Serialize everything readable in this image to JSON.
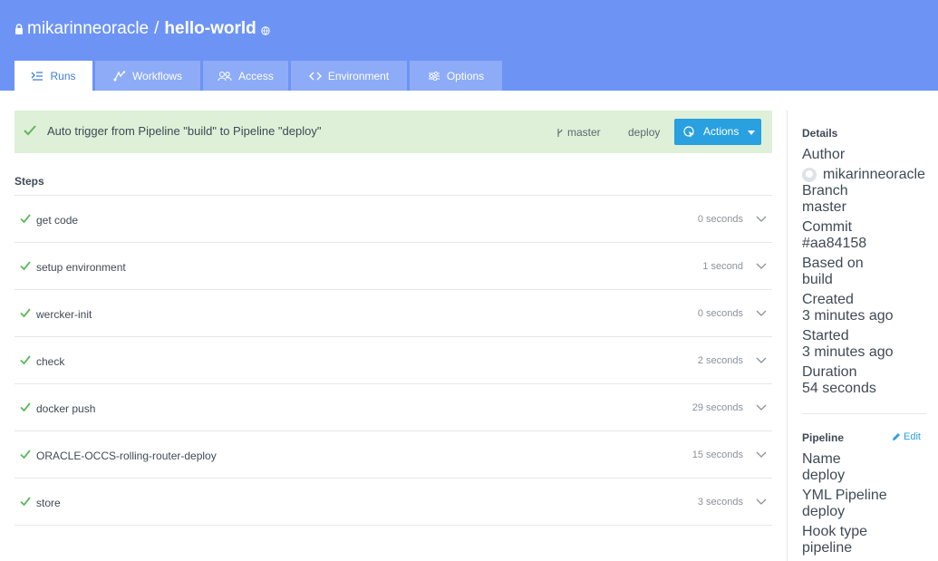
{
  "repo": {
    "owner": "mikarinneoracle",
    "separator": "/",
    "name": "hello-world"
  },
  "tabs": [
    {
      "label": "Runs",
      "icon": "runs-icon",
      "active": true
    },
    {
      "label": "Workflows",
      "icon": "workflows-icon"
    },
    {
      "label": "Access",
      "icon": "access-icon"
    },
    {
      "label": "Environment",
      "icon": "code-icon"
    },
    {
      "label": "Options",
      "icon": "options-icon"
    }
  ],
  "run": {
    "message": "Auto trigger from Pipeline \"build\" to Pipeline \"deploy\"",
    "branch": "master",
    "pipeline": "deploy",
    "actions_label": "Actions"
  },
  "steps_title": "Steps",
  "steps": [
    {
      "name": "get code",
      "duration": "0 seconds"
    },
    {
      "name": "setup environment",
      "duration": "1 second"
    },
    {
      "name": "wercker-init",
      "duration": "0 seconds"
    },
    {
      "name": "check",
      "duration": "2 seconds"
    },
    {
      "name": "docker push",
      "duration": "29 seconds"
    },
    {
      "name": "ORACLE-OCCS-rolling-router-deploy",
      "duration": "15 seconds"
    },
    {
      "name": "store",
      "duration": "3 seconds"
    }
  ],
  "details": {
    "title": "Details",
    "author_label": "Author",
    "author": "mikarinneoracle",
    "branch_label": "Branch",
    "branch": "master",
    "commit_label": "Commit",
    "commit": "#aa84158",
    "based_on_label": "Based on",
    "based_on": "build",
    "created_label": "Created",
    "created": "3 minutes ago",
    "started_label": "Started",
    "started": "3 minutes ago",
    "duration_label": "Duration",
    "duration": "54 seconds"
  },
  "pipeline": {
    "title": "Pipeline",
    "edit_label": "Edit",
    "name_label": "Name",
    "name": "deploy",
    "yml_label": "YML Pipeline",
    "yml": "deploy",
    "hook_label": "Hook type",
    "hook": "pipeline"
  },
  "colors": {
    "header": "#6d94f5",
    "banner": "#def0d8",
    "accent": "#29a0e0",
    "success": "#5cb85c"
  }
}
